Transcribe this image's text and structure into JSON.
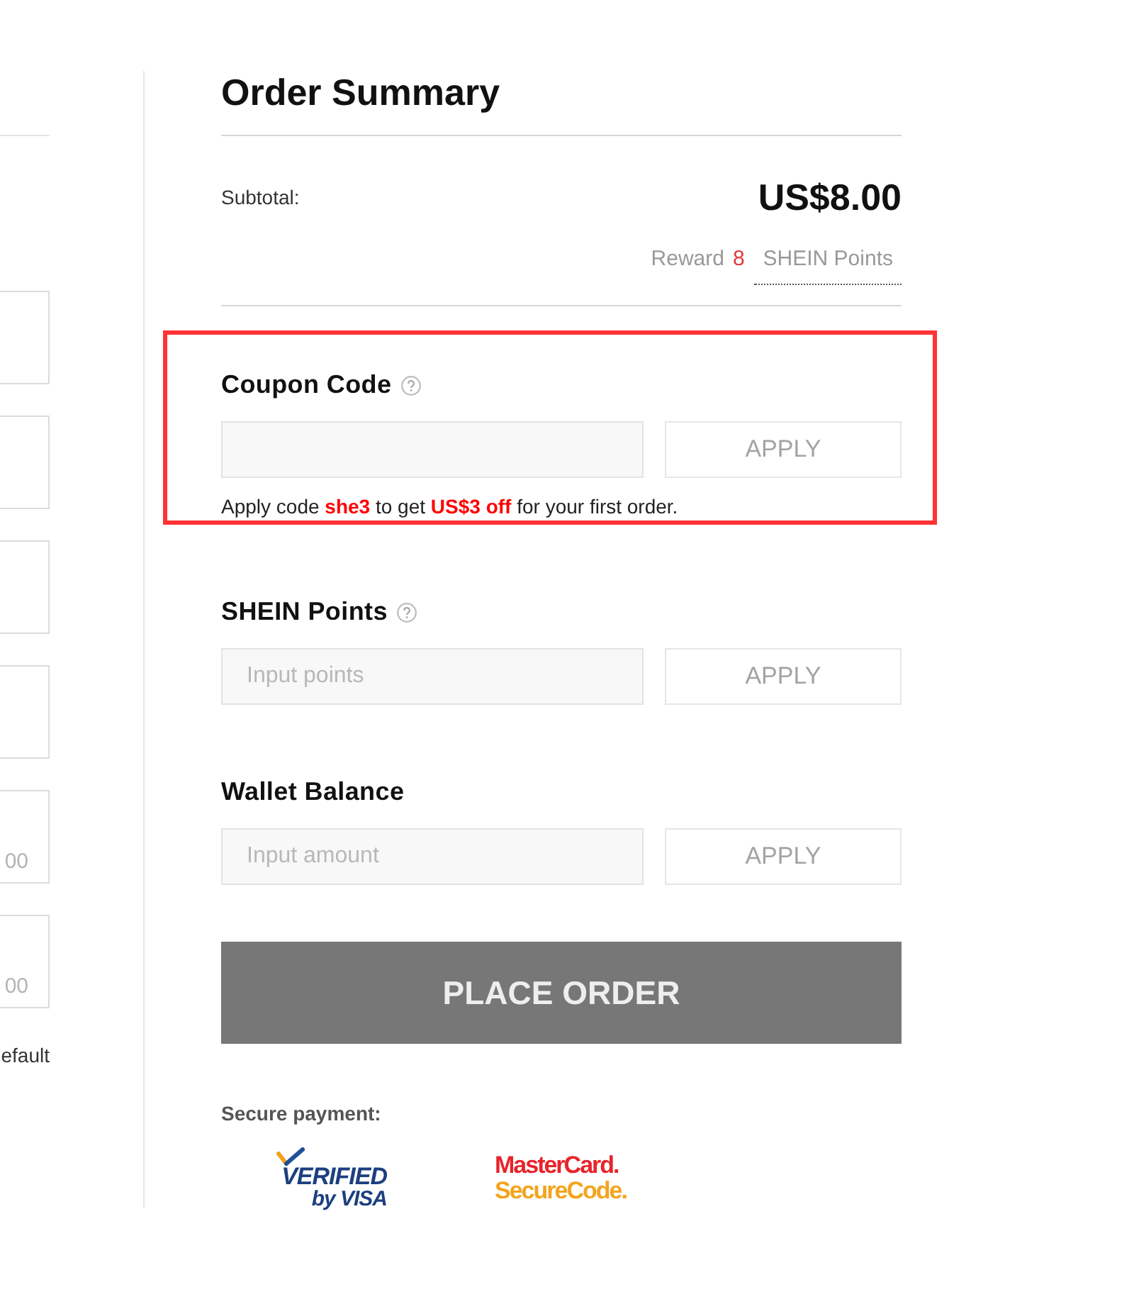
{
  "left_form": {
    "fields": [
      {
        "kind": "plain"
      },
      {
        "kind": "plain"
      },
      {
        "kind": "plain"
      },
      {
        "kind": "plain"
      },
      {
        "kind": "counted",
        "counter": "00"
      },
      {
        "kind": "counted",
        "counter": "00"
      }
    ],
    "footer_text": "efault"
  },
  "order_summary": {
    "title": "Order Summary",
    "subtotal": {
      "label": "Subtotal:",
      "amount": "US$8.00"
    },
    "reward": {
      "label": "Reward",
      "count": "8",
      "unit": "SHEIN Points"
    }
  },
  "sections": [
    {
      "title": "Coupon Code",
      "help": true,
      "highlighted": true,
      "button": {
        "label": "APPLY",
        "disabled": true
      },
      "note": "Apply code **she3** to get **US$3 off** for your first order."
    },
    {
      "title": "SHEIN Points",
      "help": true,
      "highlighted": false,
      "placeholder": "Input points",
      "button": {
        "label": "APPLY",
        "disabled": true
      }
    },
    {
      "title": "Wallet Balance",
      "help": false,
      "highlighted": false,
      "placeholder": "Input amount",
      "button": {
        "label": "APPLY",
        "disabled": true
      }
    }
  ],
  "place_order": "PLACE ORDER",
  "secure_payment": {
    "label": "Secure payment:",
    "badges": [
      {
        "kind": "visa",
        "lines": [
          "VERIFIED",
          "by VISA"
        ]
      },
      {
        "kind": "mastercard",
        "lines": [
          "MasterCard.",
          "SecureCode."
        ]
      }
    ]
  }
}
